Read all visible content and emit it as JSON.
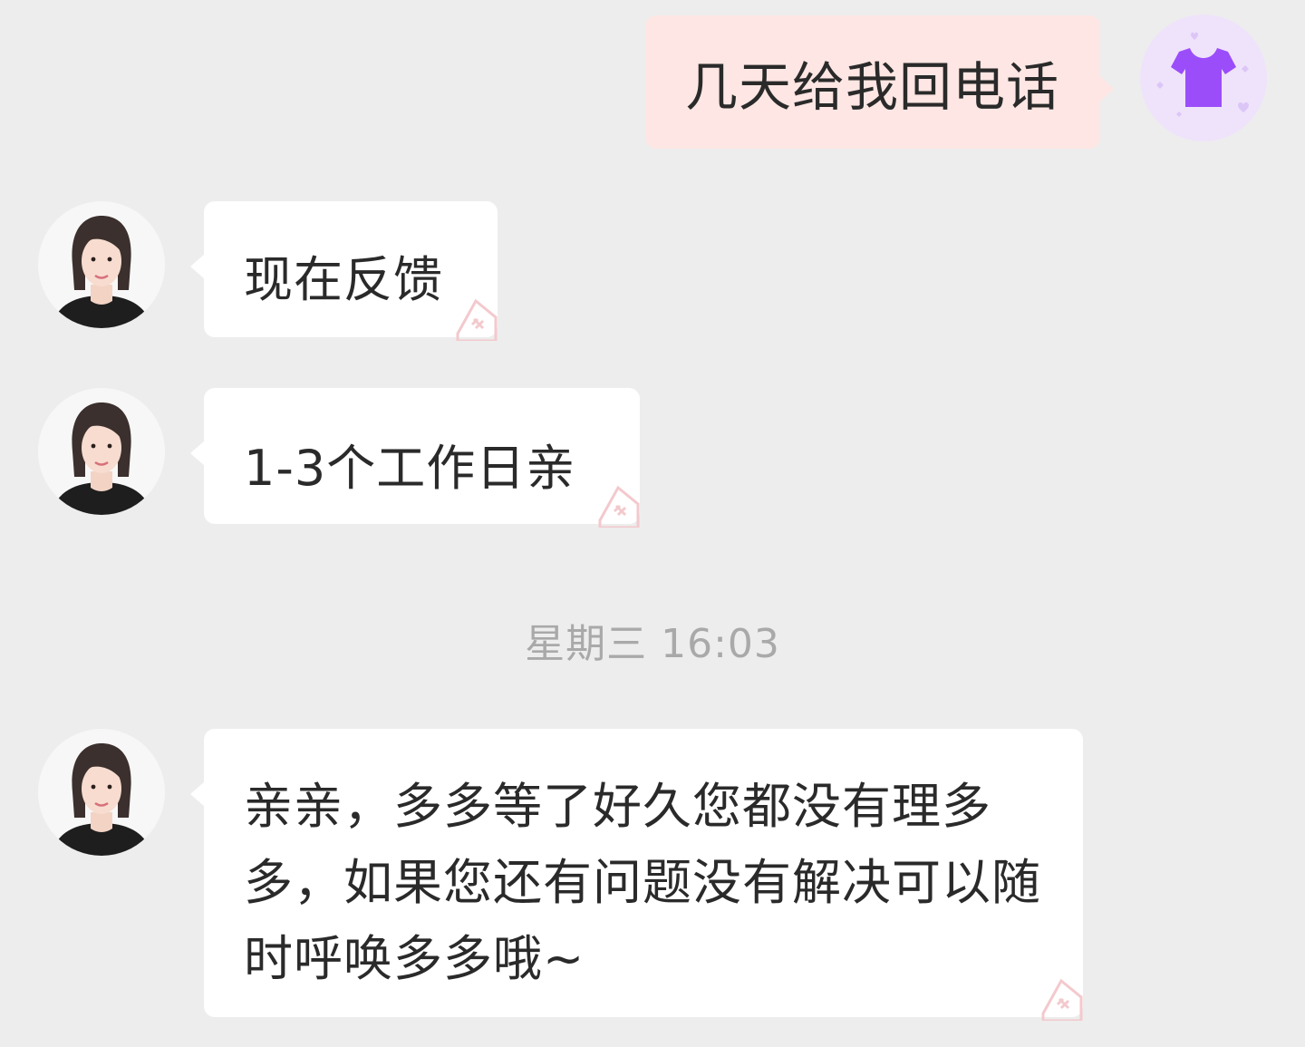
{
  "outgoing": {
    "text": "几天给我回电话"
  },
  "incoming": [
    {
      "text": "现在反馈"
    },
    {
      "text": "1-3个工作日亲"
    }
  ],
  "timestamp": "星期三 16:03",
  "incoming_after": {
    "text": "亲亲，多多等了好久您都没有理多多，如果您还有问题没有解决可以随时呼唤多多哦~"
  },
  "colors": {
    "background": "#ededed",
    "outgoing_bubble": "#fde6e3",
    "incoming_bubble": "#ffffff",
    "my_avatar_bg": "#efe3fb",
    "shirt_icon": "#9b4dfa",
    "timestamp_text": "#a9a9a9"
  },
  "icons": {
    "my_avatar": "tshirt-icon",
    "agent_avatar": "agent-avatar",
    "bubble_stamp": "heart-stamp-icon"
  }
}
